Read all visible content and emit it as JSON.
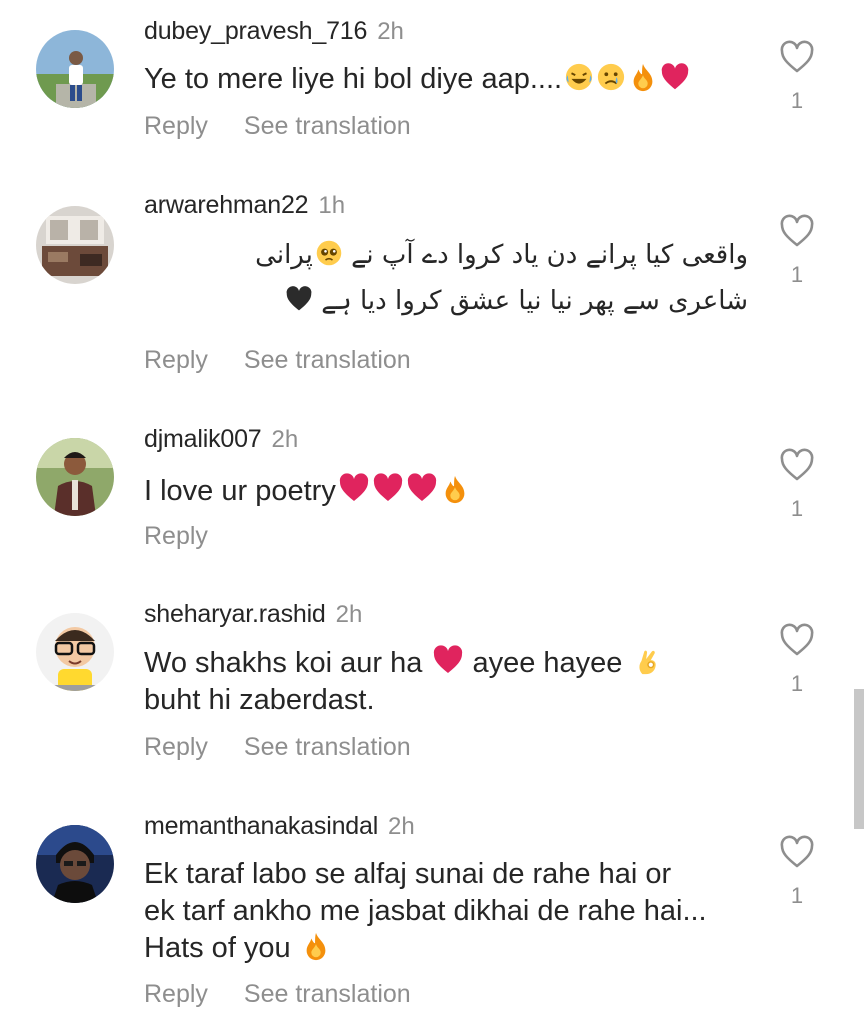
{
  "colors": {
    "text": "#262626",
    "secondary": "#8e8e8e",
    "heart_red": "#e0245e"
  },
  "comments": [
    {
      "username": "dubey_pravesh_716",
      "time": "2h",
      "text": "Ye to mere liye hi bol diye aap....",
      "emojis": [
        "laughing-crying-emoji",
        "crying-emoji",
        "fire-emoji",
        "red-heart-emoji"
      ],
      "reply": "Reply",
      "translate": "See translation",
      "likes": "1"
    },
    {
      "username": "arwarehman22",
      "time": "1h",
      "line1": "واقعی کیا پرانے دن یاد کروا دے آپ نے",
      "line1_end": "پرانی",
      "line2": "شاعری سے پھر نیا نیا عشق کروا دیا ہے",
      "emojis": [
        "pleading-face-emoji",
        "black-heart-emoji"
      ],
      "reply": "Reply",
      "translate": "See translation",
      "likes": "1"
    },
    {
      "username": "djmalik007",
      "time": "2h",
      "text": "I love ur poetry",
      "emojis": [
        "red-heart-emoji",
        "red-heart-emoji",
        "red-heart-emoji",
        "fire-emoji"
      ],
      "reply": "Reply",
      "likes": "1"
    },
    {
      "username": "sheharyar.rashid",
      "time": "2h",
      "line1a": "Wo shakhs koi aur ha",
      "line1b": "ayee hayee",
      "line2": "buht hi zaberdast.",
      "emojis": [
        "red-heart-emoji",
        "ok-hand-emoji"
      ],
      "reply": "Reply",
      "translate": "See translation",
      "likes": "1"
    },
    {
      "username": "memanthanakasindal",
      "time": "2h",
      "line1": "Ek taraf labo se alfaj sunai de rahe hai or",
      "line2": "ek tarf ankho me jasbat dikhai de rahe hai...",
      "line3": "Hats of you",
      "emojis": [
        "fire-emoji"
      ],
      "reply": "Reply",
      "translate": "See translation",
      "likes": "1"
    }
  ]
}
